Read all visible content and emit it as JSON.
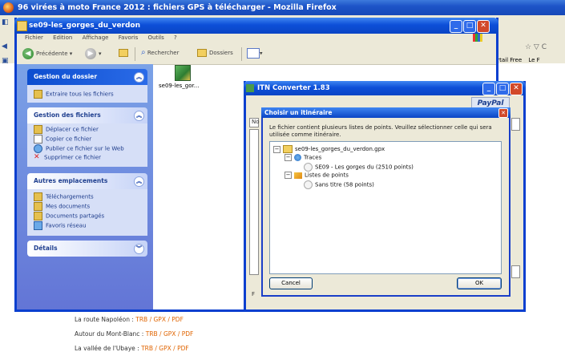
{
  "firefox": {
    "title": "96 virées à moto France 2012 : fichiers GPS à télécharger - Mozilla Firefox",
    "right_tools": "☆ ▽ C",
    "bookmarks": [
      "Portail Free",
      "Le F"
    ]
  },
  "page": {
    "links": [
      {
        "label": "La route Napoléon :",
        "formats": "TRB / GPX / PDF"
      },
      {
        "label": "Autour du Mont-Blanc :",
        "formats": "TRB / GPX / PDF"
      },
      {
        "label": "La vallée de l'Ubaye :",
        "formats": "TRB / GPX / PDF"
      }
    ]
  },
  "explorer": {
    "title": "se09-les_gorges_du_verdon",
    "menu": [
      "Fichier",
      "Edition",
      "Affichage",
      "Favoris",
      "Outils",
      "?"
    ],
    "toolbar": {
      "back": "Précédente",
      "search": "Rechercher",
      "folders": "Dossiers"
    },
    "file": {
      "name": "se09-les_gor..."
    },
    "panels": [
      {
        "title": "Gestion du dossier",
        "items": [
          "Extraire tous les fichiers"
        ]
      },
      {
        "title": "Gestion des fichiers",
        "items": [
          "Déplacer ce fichier",
          "Copier ce fichier",
          "Publier ce fichier sur le Web",
          "Supprimer ce fichier"
        ]
      },
      {
        "title": "Autres emplacements",
        "items": [
          "Téléchargements",
          "Mes documents",
          "Documents partagés",
          "Favoris réseau"
        ]
      },
      {
        "title": "Détails",
        "items": []
      }
    ]
  },
  "itn": {
    "title": "ITN Converter 1.83",
    "paypal": "PayPal",
    "ghost_letters": [
      "No",
      "F"
    ]
  },
  "dialog": {
    "title": "Choisir un itinéraire",
    "message": "Le fichier contient plusieurs listes de points. Veuillez sélectionner celle qui sera utilisée comme itinéraire.",
    "tree": {
      "root": "se09-les_gorges_du_verdon.gpx",
      "traces_label": "Traces",
      "trace_item": "SE09 - Les gorges du (2510 points)",
      "points_label": "Listes de points",
      "points_item": "Sans titre (58 points)"
    },
    "cancel": "Cancel",
    "ok": "OK"
  }
}
